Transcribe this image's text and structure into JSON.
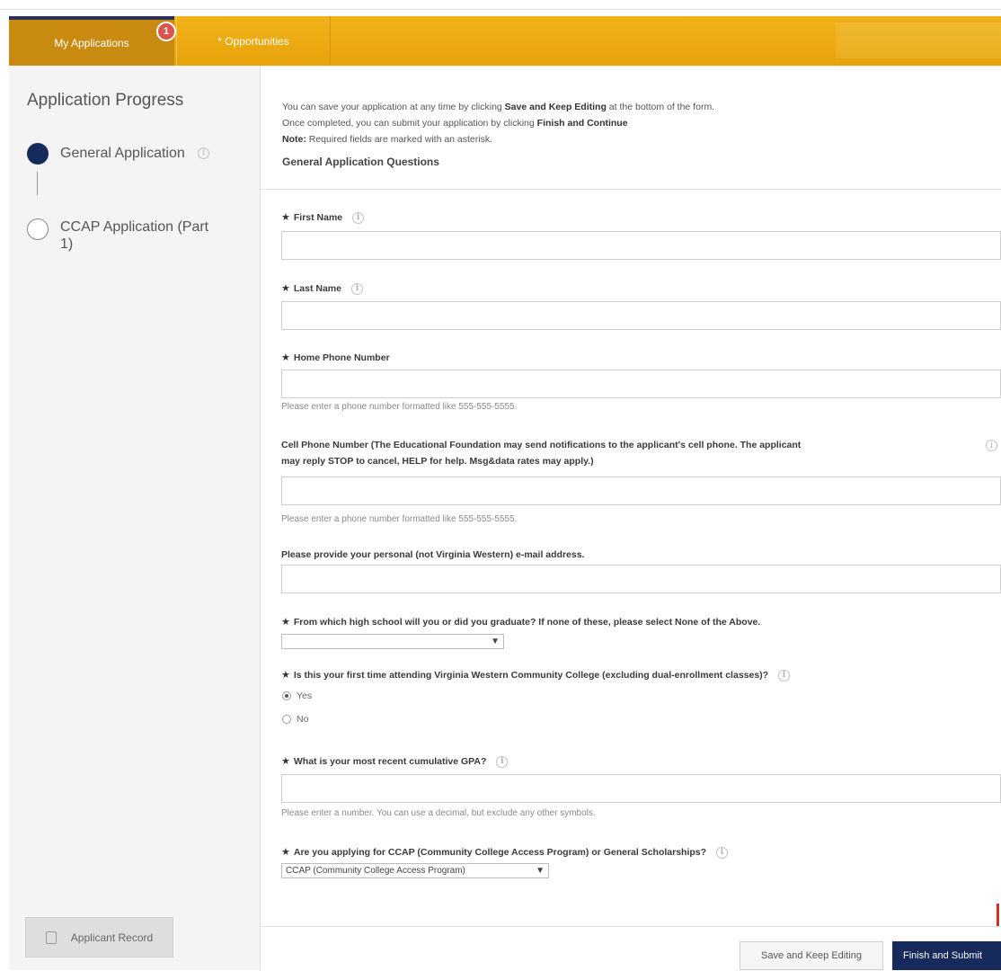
{
  "nav": {
    "my_applications": "My Applications",
    "opportunities": "* Opportunities",
    "badge_count": "1"
  },
  "sidebar": {
    "title": "Application Progress",
    "steps": [
      {
        "label": "General Application",
        "state": "current"
      },
      {
        "label": "CCAP Application (Part 1)",
        "state": "pending"
      }
    ],
    "record_button": "Applicant Record"
  },
  "intro": {
    "line1_pre": "You can save your application at any time by clicking ",
    "line1_bold": "Save and Keep Editing",
    "line1_post": " at the bottom of the form.",
    "line2_pre": "Once completed, you can submit your application by clicking ",
    "line2_bold": "Finish and Continue",
    "note_bold": "Note:",
    "note_text": " Required fields are marked with an asterisk.",
    "section_title": "General Application Questions"
  },
  "form": {
    "first_name_label": "First Name",
    "last_name_label": "Last Name",
    "home_phone_label": "Home Phone Number",
    "home_phone_hint": "Please enter a phone number formatted like 555-555-5555.",
    "cell_phone_label_line1": "Cell Phone Number (The Educational Foundation may send notifications to the applicant's cell phone. The applicant",
    "cell_phone_label_line2": "may reply STOP to cancel, HELP for help. Msg&data rates may apply.)",
    "cell_phone_hint": "Please enter a phone number formatted like 555-555-5555.",
    "email_label": "Please provide your personal (not Virginia Western) e-mail address.",
    "high_school_label": "From which high school will you or did you graduate? If none of these, please select None of the Above.",
    "high_school_value": "",
    "first_time_label": "Is this your first time attending Virginia Western Community College (excluding dual-enrollment classes)?",
    "first_time_options": [
      "Yes",
      "No"
    ],
    "first_time_selected": "Yes",
    "gpa_label": "What is your most recent cumulative GPA?",
    "gpa_hint": "Please enter a number. You can use a decimal, but exclude any other symbols.",
    "program_label": "Are you applying for CCAP (Community College Access Program) or General Scholarships?",
    "program_value": "CCAP (Community College Access Program)"
  },
  "footer": {
    "save_button": "Save and Keep Editing",
    "finish_button": "Finish and Submit"
  },
  "colors": {
    "nav_gold": "#f0b21a",
    "active_tab": "#c98a10",
    "navy": "#172a5c"
  }
}
